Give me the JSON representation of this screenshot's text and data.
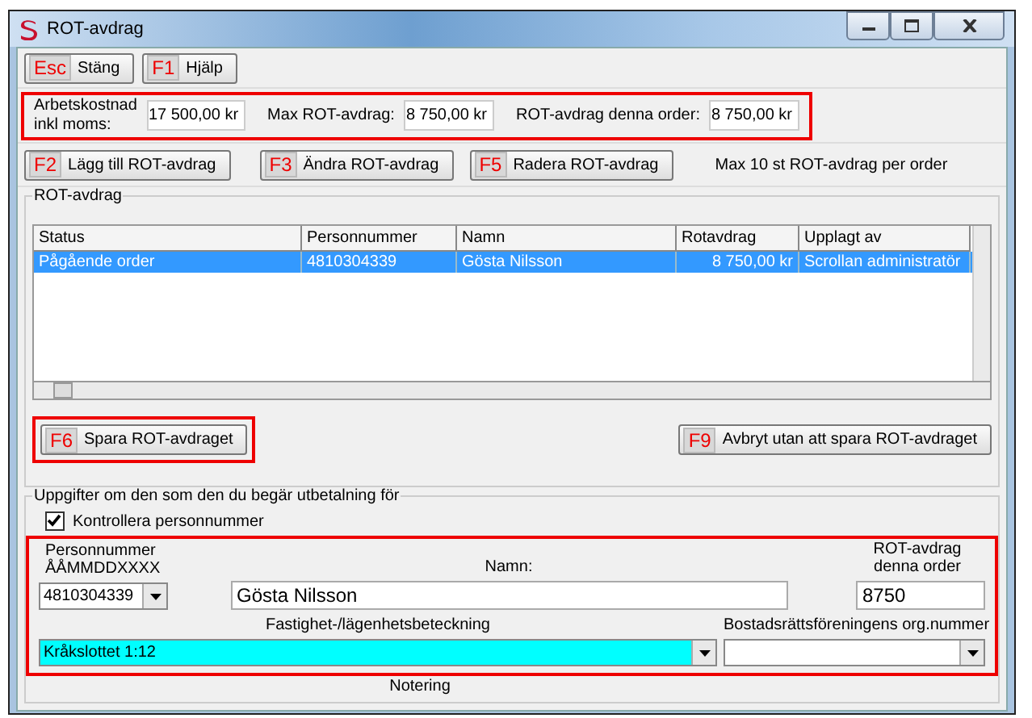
{
  "window": {
    "title": "ROT-avdrag"
  },
  "toolbar": [
    {
      "key": "Esc",
      "label": "Stäng"
    },
    {
      "key": "F1",
      "label": "Hjälp"
    }
  ],
  "costs": {
    "highlighted": true,
    "fields": [
      {
        "label": "Arbetskostnad inkl moms:",
        "value": "17 500,00 kr"
      },
      {
        "label": "Max ROT-avdrag:",
        "value": "8 750,00 kr"
      },
      {
        "label": "ROT-avdrag denna order:",
        "value": "8 750,00 kr"
      }
    ]
  },
  "actions": [
    {
      "key": "F2",
      "label": "Lägg till ROT-avdrag"
    },
    {
      "key": "F3",
      "label": "Ändra ROT-avdrag"
    },
    {
      "key": "F5",
      "label": "Radera ROT-avdrag"
    }
  ],
  "actions_note": "Max 10 st ROT-avdrag per order",
  "rot_group": {
    "title": "ROT-avdrag",
    "table": {
      "columns": [
        "Status",
        "Personnummer",
        "Namn",
        "Rotavdrag",
        "Upplagt av"
      ],
      "rows": [
        {
          "cells": [
            "Pågående order",
            "4810304339",
            "Gösta Nilsson",
            "8 750,00 kr",
            "Scrollan administratör"
          ],
          "selected": true
        }
      ]
    }
  },
  "save_button": {
    "key": "F6",
    "label": "Spara ROT-avdraget",
    "highlighted": true
  },
  "cancel_button": {
    "key": "F9",
    "label": "Avbryt utan att spara ROT-avdraget"
  },
  "details": {
    "title": "Uppgifter om den som den du begär utbetalning för",
    "check": {
      "label": "Kontrollera personnummer",
      "checked": true
    },
    "highlighted": true,
    "personnummer": {
      "label": "Personnummer ÅÅMMDDXXXX",
      "value": "4810304339"
    },
    "namn": {
      "label": "Namn:",
      "value": "Gösta Nilsson"
    },
    "rot_order": {
      "label": "ROT-avdrag denna order",
      "value": "8750"
    },
    "fastighet": {
      "label": "Fastighet-/lägenhetsbeteckning",
      "value": "Kråkslottet 1:12",
      "active": true
    },
    "org": {
      "label": "Bostadsrättsföreningens org.nummer"
    },
    "notering": {
      "label": "Notering"
    }
  }
}
